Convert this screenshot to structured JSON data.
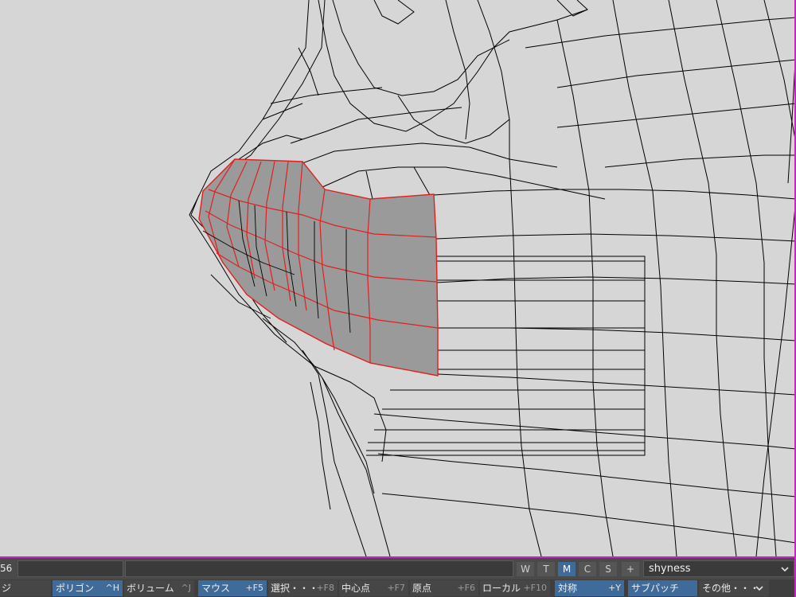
{
  "viewport": {
    "background": "#d6d6d6",
    "wire_color": "#000000",
    "selection_edge_color": "#e02020",
    "selection_fill_color": "#9a9a9a"
  },
  "status_bar": {
    "counter_text": "56",
    "input_value": "",
    "mode_buttons": [
      "W",
      "T",
      "M",
      "C",
      "S"
    ],
    "active_mode": "M",
    "add_label": "+",
    "object_dropdown": "shyness",
    "dropdown_icon": "chevron-down-icon"
  },
  "toolbar": {
    "items": [
      {
        "label": "ジ",
        "key": ""
      },
      {
        "label": "ポリゴン",
        "key": "^H"
      },
      {
        "label": "ボリューム",
        "key": "^J"
      },
      {
        "label": "マウス",
        "key": "+F5"
      },
      {
        "label": "選択・・・",
        "key": "+F8"
      },
      {
        "label": "中心点",
        "key": "+F7"
      },
      {
        "label": "原点",
        "key": "+F6"
      },
      {
        "label": "ローカル",
        "key": "+F10"
      },
      {
        "label": "対称",
        "key": "+Y"
      },
      {
        "label": "サブパッチ",
        "key": ""
      },
      {
        "label": "その他・・・",
        "key": ""
      }
    ]
  },
  "accent_color": "#3e6b9a",
  "frame_color": "#c028c0"
}
